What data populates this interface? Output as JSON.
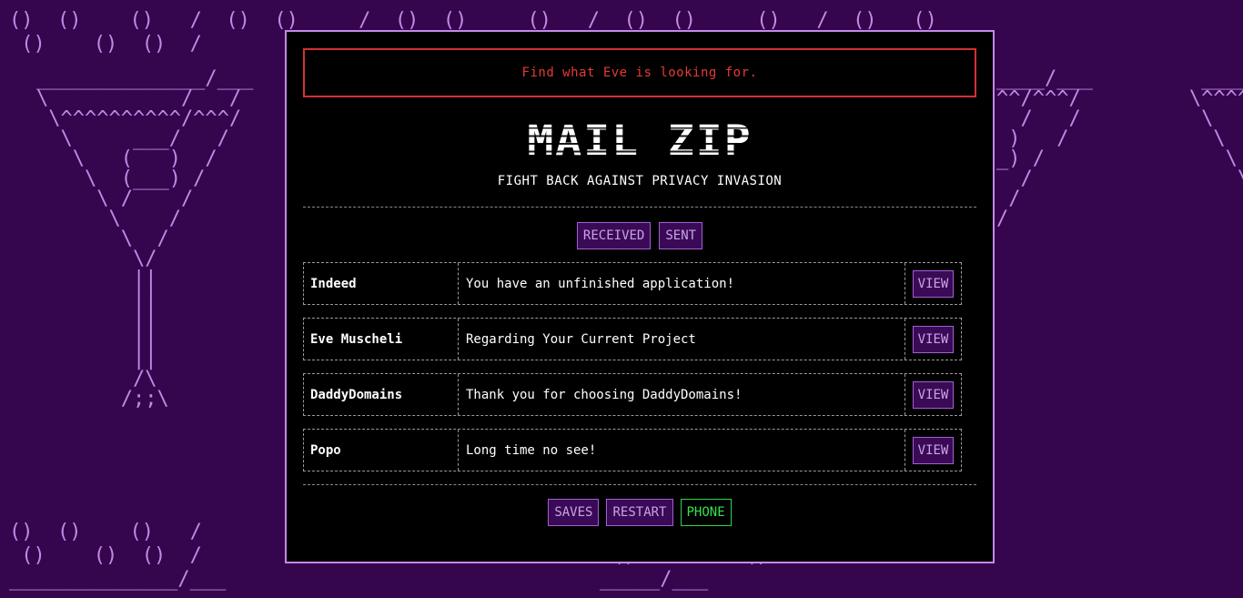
{
  "alert": {
    "message": "Find what Eve is looking for."
  },
  "logo": {
    "text": "MAIL ZIP",
    "tagline": "FIGHT BACK AGAINST PRIVACY INVASION"
  },
  "tabs": {
    "received": "RECEIVED",
    "sent": "SENT"
  },
  "mails": [
    {
      "sender": "Indeed",
      "subject": "You have an unfinished application!",
      "action": "VIEW"
    },
    {
      "sender": "Eve Muscheli",
      "subject": "Regarding Your Current Project",
      "action": "VIEW"
    },
    {
      "sender": "DaddyDomains",
      "subject": "Thank you for choosing DaddyDomains!",
      "action": "VIEW"
    },
    {
      "sender": "Popo",
      "subject": "Long time no see!",
      "action": "VIEW"
    }
  ],
  "footer": {
    "saves": "SAVES",
    "restart": "RESTART",
    "phone": "PHONE"
  },
  "colors": {
    "background": "#35064e",
    "ascii_art": "#c489e6",
    "alert": "#e53a34",
    "button_bg": "#3a0a57",
    "phone_green": "#35e34f"
  }
}
